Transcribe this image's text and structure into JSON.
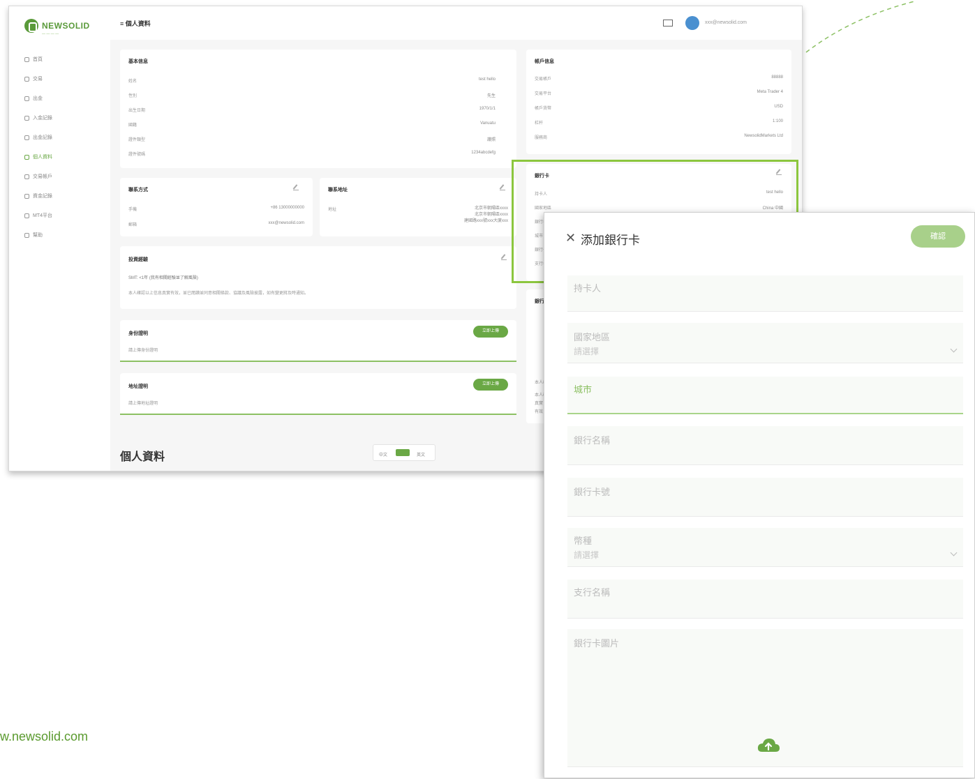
{
  "colors": {
    "brand_green": "#6aa845",
    "light_green": "#a8d08a",
    "highlight": "#8cc63e"
  },
  "background_app": {
    "logo": {
      "text": "NEWSOLID",
      "subtitle": "— — — —"
    },
    "header": {
      "breadcrumb": "≡  個人資料",
      "email": "xxx@newsolid.com"
    },
    "sidebar": {
      "items": [
        {
          "label": "首頁",
          "icon": "home-icon",
          "active": false
        },
        {
          "label": "交易",
          "icon": "trade-icon",
          "active": false
        },
        {
          "label": "出金",
          "icon": "withdraw-icon",
          "active": false
        },
        {
          "label": "入金記錄",
          "icon": "deposit-icon",
          "active": false
        },
        {
          "label": "出金記錄",
          "icon": "record-icon",
          "active": false
        },
        {
          "label": "個人資料",
          "icon": "profile-icon",
          "active": true
        },
        {
          "label": "交易帳戶",
          "icon": "account-icon",
          "active": false
        },
        {
          "label": "資金記錄",
          "icon": "funds-icon",
          "active": false
        },
        {
          "label": "MT4平台",
          "icon": "platform-icon",
          "active": false
        },
        {
          "label": "幫助",
          "icon": "help-icon",
          "active": false
        }
      ]
    },
    "basic_info": {
      "title": "基本信息",
      "rows": [
        {
          "label": "姓名",
          "value": "test hello"
        },
        {
          "label": "性別",
          "value": "先生"
        },
        {
          "label": "出生日期",
          "value": "1970/1/1"
        },
        {
          "label": "國籍",
          "value": "Vanuatu"
        },
        {
          "label": "證件類型",
          "value": "護照"
        },
        {
          "label": "證件號碼",
          "value": "1234abcdefg"
        }
      ]
    },
    "account_info": {
      "title": "帳戶信息",
      "rows": [
        {
          "label": "交易帳戶",
          "value": "88888"
        },
        {
          "label": "交易平台",
          "value": "Meta Trader 4"
        },
        {
          "label": "帳戶貨幣",
          "value": "USD"
        },
        {
          "label": "杠杆",
          "value": "1:100"
        },
        {
          "label": "服務商",
          "value": "NewsolidMarkets Ltd"
        }
      ]
    },
    "contact": {
      "title": "聯系方式",
      "rows": [
        {
          "label": "手機",
          "value": "+86 13000000000"
        },
        {
          "label": "郵箱",
          "value": "xxx@newsolid.com"
        }
      ]
    },
    "address": {
      "title": "聯系地址",
      "label": "地址",
      "lines": [
        "北京市朝陽區xxxx",
        "北京市朝陽區xxxx",
        "建國路xxx號xxx大廈xxx"
      ]
    },
    "bank_card": {
      "title": "銀行卡",
      "rows": [
        {
          "label": "持卡人",
          "value": "test hello"
        },
        {
          "label": "國家地區",
          "value": "China 中國"
        },
        {
          "label": "銀行名稱",
          "value": ""
        },
        {
          "label": "城市",
          "value": ""
        },
        {
          "label": "銀行卡號",
          "value": ""
        },
        {
          "label": "支行名稱",
          "value": ""
        }
      ]
    },
    "bank_photo_label": "銀行卡",
    "investment": {
      "title": "投資經驗",
      "line1": "SMT: <1年 (我有相關經驗並了解風險)",
      "line2": "本人確認以上信息真實有效，並已閱讀並同意相關條款、協議及風險披露，如有變更將及時通知。"
    },
    "id_proof": {
      "title": "身份證明",
      "hint": "請上傳身份證明",
      "button": "立即上傳"
    },
    "address_proof": {
      "title": "地址證明",
      "hint": "請上傳地址證明",
      "button": "立即上傳"
    },
    "side_notes": [
      "本人確認",
      "本人確認以上信息",
      "真實",
      "有效"
    ],
    "big_title": "個人資料",
    "toggle": {
      "left": "中文",
      "right": "英文"
    }
  },
  "dialog": {
    "title": "添加銀行卡",
    "confirm": "確認",
    "fields": [
      {
        "label": "持卡人",
        "value": "",
        "select": false
      },
      {
        "label": "國家地區",
        "value": "請選擇",
        "select": true
      },
      {
        "label": "城市",
        "value": "",
        "select": false,
        "focused": true
      },
      {
        "label": "銀行名稱",
        "value": "",
        "select": false
      },
      {
        "label": "銀行卡號",
        "value": "",
        "select": false
      },
      {
        "label": "幣種",
        "value": "請選擇",
        "select": true
      },
      {
        "label": "支行名稱",
        "value": "",
        "select": false
      },
      {
        "label": "銀行卡圖片",
        "value": "",
        "select": false,
        "upload": true
      }
    ]
  },
  "website": "w.newsolid.com"
}
